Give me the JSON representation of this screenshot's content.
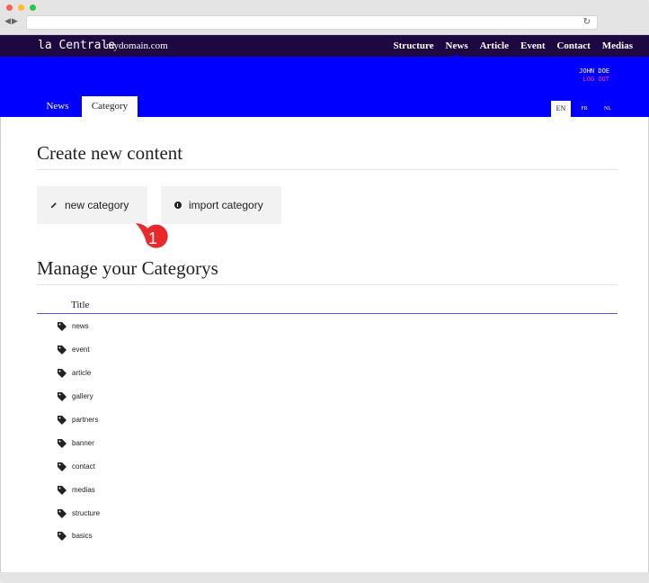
{
  "topnav": {
    "brand": "la Centrale",
    "domain": "mydomain.com",
    "menu": [
      "Structure",
      "News",
      "Article",
      "Event",
      "Contact",
      "Medias"
    ],
    "active_menu": "News"
  },
  "header": {
    "user_name": "JOHN DOE",
    "logout": "LOG OUT",
    "subtabs": [
      "News",
      "Category"
    ],
    "languages": [
      "EN",
      "FR",
      "NL"
    ]
  },
  "main": {
    "create_title": "Create new content",
    "new_button": "new category",
    "import_button": "import category",
    "step_badge": "1",
    "manage_title": "Manage your Categorys",
    "table_header": "Title",
    "rows": [
      "news",
      "event",
      "article",
      "gallery",
      "partners",
      "banner",
      "contact",
      "medias",
      "structure",
      "basics"
    ]
  },
  "colors": {
    "topnav_bg": "#1e0842",
    "accent_blue": "#0000ff",
    "logout": "#ff3a8c",
    "badge": "#e8282b"
  },
  "icons": {
    "new_button": "pencil-icon",
    "import_button": "plus-circle-icon",
    "row": "tag-icon",
    "reload": "reload-icon"
  }
}
